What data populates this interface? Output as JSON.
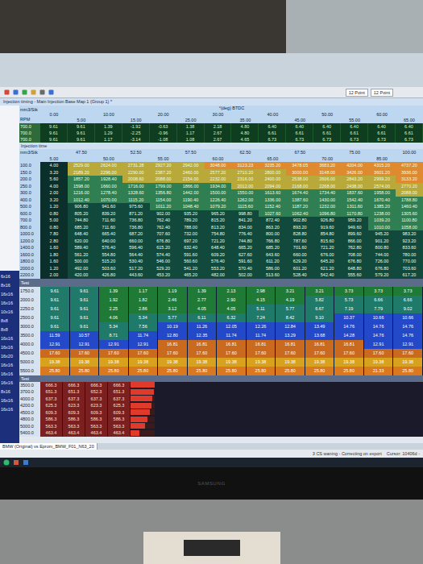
{
  "window": {
    "title": "Injection timing - Main Injection Base Map 1 (Group 1) *"
  },
  "toolbar": {
    "font_sizes": [
      "12 Point",
      "12 Point"
    ]
  },
  "axis_map": {
    "axis_title": "°(deg) BTDC",
    "corner_top": "mm3/Stk",
    "corner_bottom": "RPM",
    "columns": [
      "0.00",
      "5.00",
      "10.00",
      "15.00",
      "20.00",
      "25.00",
      "30.00",
      "35.00",
      "40.00",
      "45.00",
      "50.00",
      "55.00",
      "60.00",
      "65.00"
    ],
    "rows": [
      {
        "label": "700.0",
        "values": [
          "9.61",
          "9.61",
          "1.39",
          "-1.92",
          "-0.63",
          "1.38",
          "2.18",
          "4.80",
          "6.40",
          "6.40",
          "6.40",
          "6.40",
          "6.40",
          "6.40"
        ]
      },
      {
        "label": "700.0",
        "values": [
          "9.61",
          "9.61",
          "1.29",
          "-2.25",
          "-0.96",
          "1.17",
          "2.67",
          "4.80",
          "6.61",
          "6.61",
          "6.61",
          "6.61",
          "6.61",
          "6.61"
        ]
      },
      {
        "label": "700.0",
        "values": [
          "9.61",
          "9.61",
          "1.17",
          "-3.14",
          "-1.08",
          "1.08",
          "2.67",
          "4.65",
          "6.73",
          "6.73",
          "6.73",
          "6.73",
          "6.73",
          "6.73"
        ]
      }
    ]
  },
  "time_map": {
    "title": "Injection time",
    "corner": "mm3/Stk",
    "columns": [
      "5.00",
      "47.50",
      "50.00",
      "52.50",
      "55.00",
      "57.50",
      "60.00",
      "62.50",
      "65.00",
      "67.50",
      "70.00",
      "75.00",
      "85.00",
      "100.00"
    ],
    "rows": [
      {
        "label": "100.0",
        "values": [
          "4.00",
          "2529.00",
          "2624.00",
          "2731.28",
          "2927.20",
          "2942.00",
          "3048.00",
          "3123.23",
          "3235.20",
          "3478.05",
          "3683.20",
          "4204.00",
          "4315.20",
          "4737.20"
        ]
      },
      {
        "label": "150.0",
        "values": [
          "3.20",
          "2189.20",
          "2296.00",
          "2290.00",
          "2387.20",
          "2460.00",
          "2577.20",
          "2710.20",
          "2800.00",
          "3000.00",
          "3148.00",
          "3426.00",
          "3601.20",
          "3936.00"
        ]
      },
      {
        "label": "200.0",
        "values": [
          "5.60",
          "1857.20",
          "1928.40",
          "2008.60",
          "2088.00",
          "2154.00",
          "2232.00",
          "2316.00",
          "2400.00",
          "2538.00",
          "2606.00",
          "2843.20",
          "2999.20",
          "3133.20"
        ]
      },
      {
        "label": "250.0",
        "values": [
          "4.00",
          "1598.00",
          "1660.00",
          "1716.00",
          "1799.00",
          "1866.00",
          "1934.00",
          "2012.00",
          "2094.00",
          "2168.00",
          "2268.00",
          "2438.00",
          "2574.00",
          "2770.20"
        ]
      },
      {
        "label": "300.0",
        "values": [
          "2.00",
          "1216.00",
          "1278.40",
          "1328.60",
          "1356.80",
          "1442.00",
          "1500.00",
          "1550.00",
          "1613.60",
          "1674.40",
          "1734.40",
          "1837.60",
          "1958.00",
          "2088.00"
        ]
      },
      {
        "label": "400.0",
        "values": [
          "3.20",
          "1012.40",
          "1070.00",
          "1115.20",
          "1154.00",
          "1190.40",
          "1226.40",
          "1262.00",
          "1336.00",
          "1387.60",
          "1430.00",
          "1542.40",
          "1670.40",
          "1788.80"
        ]
      },
      {
        "label": "500.0",
        "values": [
          "1.20",
          "906.80",
          "941.60",
          "975.60",
          "1011.20",
          "1048.40",
          "1079.20",
          "1115.60",
          "1152.40",
          "1187.20",
          "1232.00",
          "1311.60",
          "1385.20",
          "1460.40"
        ]
      },
      {
        "label": "600.0",
        "values": [
          "0.80",
          "805.20",
          "839.20",
          "871.20",
          "902.00",
          "935.20",
          "965.20",
          "998.80",
          "1027.60",
          "1062.40",
          "1096.80",
          "1170.80",
          "1238.00",
          "1305.60"
        ]
      },
      {
        "label": "700.0",
        "values": [
          "5.00",
          "744.80",
          "711.60",
          "736.80",
          "762.40",
          "789.20",
          "815.20",
          "841.20",
          "872.40",
          "902.80",
          "926.80",
          "959.20",
          "1039.20",
          "1100.80"
        ]
      },
      {
        "label": "800.0",
        "values": [
          "0.80",
          "685.20",
          "711.60",
          "736.80",
          "762.40",
          "788.00",
          "813.20",
          "834.00",
          "863.20",
          "893.20",
          "919.60",
          "949.60",
          "1010.00",
          "1058.00"
        ]
      },
      {
        "label": "1000.0",
        "values": [
          "7.80",
          "648.40",
          "665.40",
          "687.20",
          "707.60",
          "732.00",
          "754.80",
          "776.40",
          "800.00",
          "828.80",
          "854.80",
          "899.60",
          "945.20",
          "983.20"
        ]
      },
      {
        "label": "1200.0",
        "values": [
          "2.80",
          "620.00",
          "640.00",
          "660.00",
          "676.80",
          "697.20",
          "721.20",
          "744.80",
          "766.80",
          "787.60",
          "815.60",
          "866.00",
          "901.20",
          "923.20"
        ]
      },
      {
        "label": "1400.0",
        "values": [
          "1.60",
          "589.40",
          "576.40",
          "596.40",
          "615.20",
          "632.40",
          "648.40",
          "665.20",
          "685.20",
          "701.60",
          "721.20",
          "762.80",
          "800.80",
          "833.60"
        ]
      },
      {
        "label": "1600.0",
        "values": [
          "1.80",
          "561.20",
          "554.80",
          "564.40",
          "574.40",
          "591.60",
          "609.20",
          "627.60",
          "643.60",
          "660.00",
          "676.00",
          "708.00",
          "744.00",
          "780.00"
        ]
      },
      {
        "label": "1800.0",
        "values": [
          "1.60",
          "500.00",
          "515.20",
          "530.40",
          "546.00",
          "560.60",
          "576.40",
          "591.60",
          "611.20",
          "629.20",
          "645.20",
          "676.80",
          "726.00",
          "770.00"
        ]
      },
      {
        "label": "2000.0",
        "values": [
          "1.20",
          "492.00",
          "503.60",
          "517.20",
          "529.20",
          "541.20",
          "553.20",
          "570.40",
          "586.00",
          "601.20",
          "621.20",
          "648.80",
          "676.80",
          "703.60"
        ]
      },
      {
        "label": "2200.0",
        "values": [
          "2.00",
          "420.00",
          "426.80",
          "443.60",
          "453.20",
          "465.20",
          "482.00",
          "502.00",
          "513.60",
          "528.40",
          "542.40",
          "555.60",
          "579.20",
          "617.20"
        ]
      }
    ]
  },
  "sidebar": {
    "items": [
      "6x16",
      "8x16",
      "16x16",
      "16x16",
      "10x16",
      "8x8",
      "8x8",
      "16x16",
      "16x16",
      "16x20",
      "16x16",
      "16x16",
      "16x16",
      "8x16",
      "16x16",
      "16x16"
    ]
  },
  "heat_map": {
    "tab": "Test",
    "rows": [
      {
        "label": "1750.0",
        "values": [
          "9.61",
          "9.61",
          "1.39",
          "1.17",
          "1.19",
          "1.39",
          "2.13",
          "2.98",
          "3.21",
          "3.21",
          "3.73",
          "3.73",
          "3.73"
        ]
      },
      {
        "label": "2000.0",
        "values": [
          "9.61",
          "9.61",
          "1.92",
          "1.82",
          "2.46",
          "2.77",
          "2.90",
          "4.15",
          "4.19",
          "5.82",
          "5.73",
          "6.66",
          "6.66"
        ]
      },
      {
        "label": "2250.0",
        "values": [
          "9.61",
          "9.61",
          "2.25",
          "2.86",
          "3.12",
          "4.05",
          "4.05",
          "5.11",
          "5.77",
          "6.67",
          "7.19",
          "7.79",
          "9.02"
        ]
      },
      {
        "label": "2500.0",
        "values": [
          "9.61",
          "9.61",
          "4.06",
          "5.34",
          "5.77",
          "6.11",
          "6.32",
          "7.24",
          "8.42",
          "9.10",
          "10.37",
          "10.66",
          "10.66"
        ]
      },
      {
        "label": "3000.0",
        "values": [
          "9.61",
          "9.61",
          "5.34",
          "7.56",
          "10.19",
          "11.26",
          "12.05",
          "12.26",
          "12.84",
          "13.49",
          "14.76",
          "14.76",
          "14.76"
        ]
      },
      {
        "label": "3500.0",
        "values": [
          "11.59",
          "10.57",
          "8.71",
          "11.74",
          "12.80",
          "12.35",
          "11.74",
          "11.74",
          "13.29",
          "13.68",
          "14.28",
          "14.76",
          "14.76"
        ]
      },
      {
        "label": "4000.0",
        "values": [
          "12.91",
          "12.91",
          "12.91",
          "12.91",
          "16.81",
          "16.81",
          "16.81",
          "16.81",
          "16.81",
          "16.81",
          "16.81",
          "12.91",
          "12.91"
        ]
      },
      {
        "label": "4500.0",
        "values": [
          "17.60",
          "17.60",
          "17.60",
          "17.60",
          "17.60",
          "17.60",
          "17.60",
          "17.60",
          "17.60",
          "17.60",
          "17.60",
          "17.60",
          "17.60"
        ]
      },
      {
        "label": "5000.0",
        "values": [
          "19.38",
          "19.38",
          "19.38",
          "19.38",
          "19.38",
          "19.38",
          "19.38",
          "19.38",
          "19.38",
          "19.38",
          "19.38",
          "19.38",
          "19.38"
        ]
      },
      {
        "label": "5500.0",
        "values": [
          "25.80",
          "25.80",
          "25.80",
          "25.80",
          "25.80",
          "25.80",
          "25.80",
          "25.80",
          "25.80",
          "25.80",
          "25.80",
          "21.33",
          "25.80"
        ]
      }
    ]
  },
  "limit_map": {
    "tab": "Test",
    "rows": [
      {
        "label": "3500.0",
        "values": [
          "666.3",
          "666.3",
          "666.3",
          "666.3"
        ],
        "level": 1
      },
      {
        "label": "3700.0",
        "values": [
          "651.3",
          "651.3",
          "652.3",
          "651.3"
        ],
        "level": 0.95
      },
      {
        "label": "4000.0",
        "values": [
          "637.3",
          "637.3",
          "637.3",
          "637.3"
        ],
        "level": 0.9
      },
      {
        "label": "4200.0",
        "values": [
          "625.3",
          "623.3",
          "623.3",
          "625.3"
        ],
        "level": 0.85
      },
      {
        "label": "4500.0",
        "values": [
          "609.3",
          "609.3",
          "609.3",
          "609.3"
        ],
        "level": 0.8
      },
      {
        "label": "4800.0",
        "values": [
          "586.3",
          "586.3",
          "586.3",
          "586.3"
        ],
        "level": 0.7
      },
      {
        "label": "5000.0",
        "values": [
          "563.3",
          "563.3",
          "563.3",
          "563.3"
        ],
        "level": 0.6
      },
      {
        "label": "5400.0",
        "values": [
          "463.4",
          "463.4",
          "463.4",
          "463.4"
        ],
        "level": 0.35
      }
    ]
  },
  "document_tab": "BMW (Original) vs Eprom_BMW_F01_N63_20",
  "status_bar": {
    "message": "3 CS waning - Correcting on export",
    "cursor": "Cursor: 10406d -"
  },
  "monitor": {
    "brand": "SAMSUNG"
  }
}
